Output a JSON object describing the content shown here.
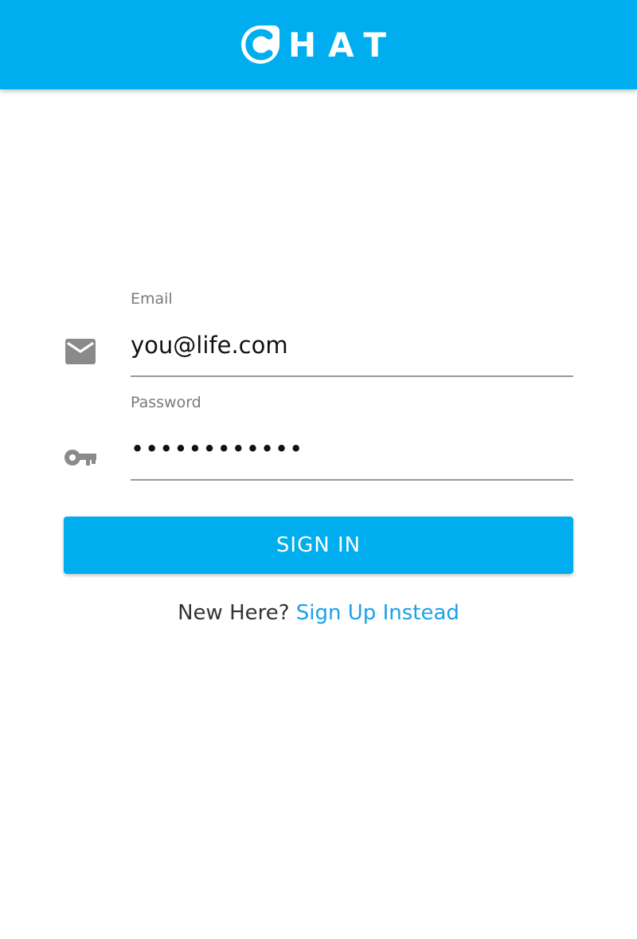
{
  "header": {
    "logo_text": "HAT",
    "logo_letter": "C",
    "background_color": "#00aeef"
  },
  "form": {
    "email": {
      "label": "Email",
      "value": "you@life.com",
      "icon": "mail-icon"
    },
    "password": {
      "label": "Password",
      "value": "••••••••••••",
      "icon": "key-icon"
    },
    "submit_label": "SIGN IN"
  },
  "footer": {
    "prompt": "New Here?",
    "link_label": "Sign Up Instead",
    "link_color": "#1ca1e6"
  }
}
